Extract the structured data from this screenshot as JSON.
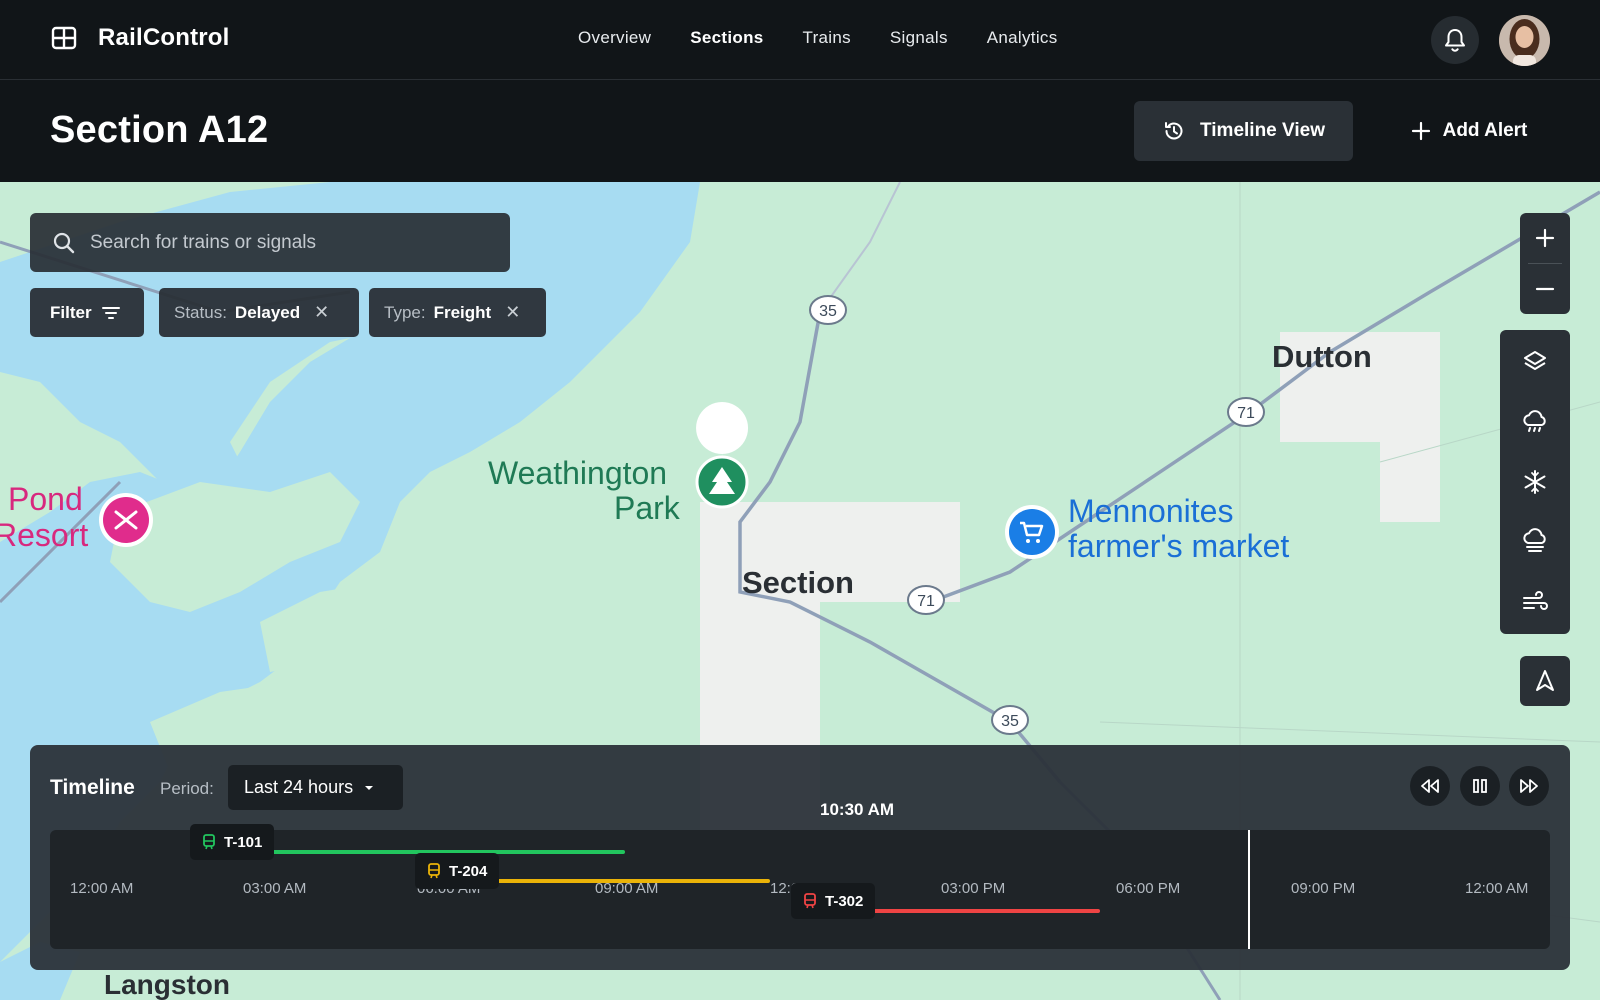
{
  "app": {
    "name": "RailControl"
  },
  "nav": {
    "items": [
      {
        "label": "Overview"
      },
      {
        "label": "Sections"
      },
      {
        "label": "Trains"
      },
      {
        "label": "Signals"
      },
      {
        "label": "Analytics"
      }
    ],
    "active": "Sections"
  },
  "page": {
    "title": "Section A12"
  },
  "header_actions": {
    "timeline_label": "Timeline View",
    "add_alert_label": "Add Alert"
  },
  "search": {
    "placeholder": "Search for trains or signals"
  },
  "filters": {
    "filter_label": "Filter",
    "chips": [
      {
        "key": "Status:",
        "value": "Delayed"
      },
      {
        "key": "Type:",
        "value": "Freight"
      }
    ]
  },
  "map": {
    "labels": {
      "dutton": "Dutton",
      "park": "Weathington Park",
      "park_line1": "Weathington",
      "park_line2": "Park",
      "market_line1": "Mennonites",
      "market_line2": "farmer's market",
      "section": "Section",
      "pond_line1": "Pond",
      "pond_line2": "Resort",
      "langston": "Langston"
    },
    "route_shields": [
      "35",
      "71",
      "71",
      "35"
    ],
    "layer_tools": [
      "layers-icon",
      "rain-icon",
      "snow-icon",
      "fog-icon",
      "wind-icon"
    ],
    "colors": {
      "land": "#c7ecd6",
      "water": "#9fd6f0",
      "urban": "#eef0ee",
      "road": "#8fa0b8"
    }
  },
  "timeline": {
    "title": "Timeline",
    "period_label": "Period:",
    "period_value": "Last 24 hours",
    "current_time": "10:30 AM",
    "ticks": [
      "12:00 AM",
      "03:00 AM",
      "06:00 AM",
      "09:00 AM",
      "12:00 PM",
      "03:00 PM",
      "06:00 PM",
      "09:00 PM",
      "12:00 AM"
    ],
    "trains": [
      {
        "id": "T-101",
        "color": "#22c55e"
      },
      {
        "id": "T-204",
        "color": "#eab308"
      },
      {
        "id": "T-302",
        "color": "#ef4444"
      }
    ]
  }
}
